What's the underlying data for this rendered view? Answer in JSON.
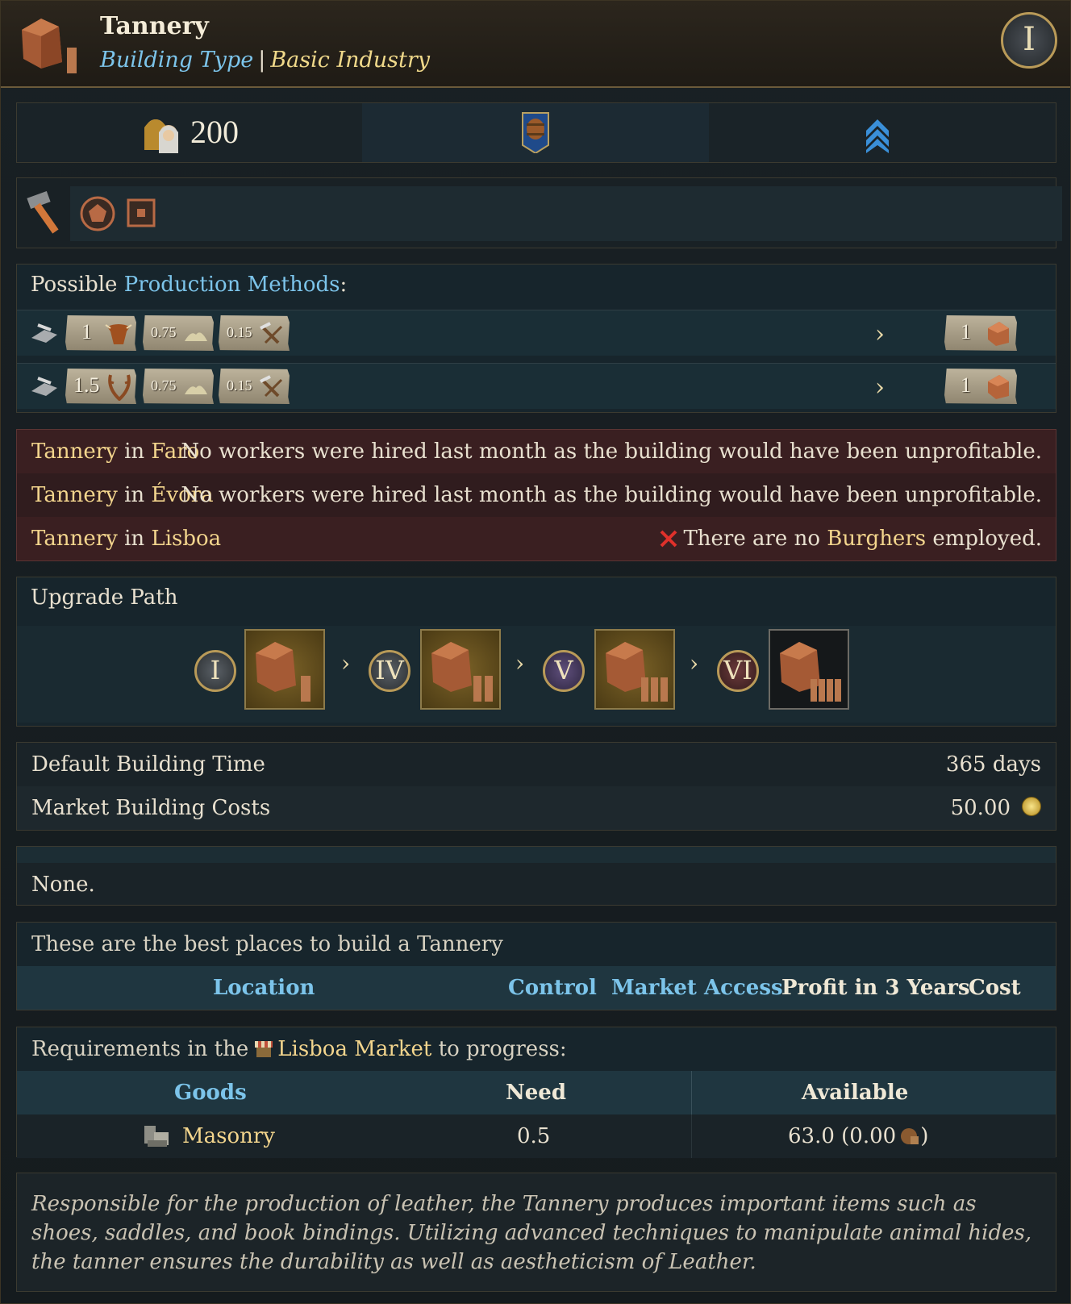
{
  "header": {
    "title": "Tannery",
    "type_label": "Building Type",
    "category": "Basic Industry",
    "tier": "I",
    "icon": "leather-building-icon"
  },
  "stats": {
    "population": "200",
    "population_icon": "population-icon",
    "slot2_icon": "barrel-banner-icon",
    "slot3_icon": "double-chevron-icon"
  },
  "tools": {
    "icons": [
      "hammer-icon",
      "pentagon-icon",
      "square-icon"
    ]
  },
  "production": {
    "label_prefix": "Possible",
    "label_highlight": "Production Methods",
    "label_suffix": ":",
    "methods": [
      {
        "inputs": [
          {
            "amount": "1",
            "icon": "cattle-icon"
          },
          {
            "amount": "0.75",
            "icon": "salt-icon"
          },
          {
            "amount": "0.15",
            "icon": "tools-icon"
          }
        ],
        "output": {
          "amount": "1",
          "icon": "leather-icon"
        }
      },
      {
        "inputs": [
          {
            "amount": "1.5",
            "icon": "antlers-icon"
          },
          {
            "amount": "0.75",
            "icon": "salt-icon"
          },
          {
            "amount": "0.15",
            "icon": "tools-icon"
          }
        ],
        "output": {
          "amount": "1",
          "icon": "leather-icon"
        }
      }
    ]
  },
  "issues": [
    {
      "building": "Tannery",
      "in": "in",
      "location": "Faro",
      "message": "No workers were hired last month as the building would have been unprofitable."
    },
    {
      "building": "Tannery",
      "in": "in",
      "location": "Évora",
      "message": "No workers were hired last month as the building would have been unprofitable."
    },
    {
      "building": "Tannery",
      "in": "in",
      "location": "Lisboa",
      "msg_pre": "There are no",
      "msg_hl": "Burghers",
      "msg_post": "employed."
    }
  ],
  "upgrade": {
    "title": "Upgrade Path",
    "tiers": [
      "I",
      "IV",
      "V",
      "VI"
    ]
  },
  "info": {
    "build_time_label": "Default Building Time",
    "build_time_value": "365 days",
    "cost_label": "Market Building Costs",
    "cost_value": "50.00"
  },
  "none_text": "None.",
  "best_places": {
    "title": "These are the best places to build a Tannery",
    "columns": [
      "Location",
      "Control",
      "Market Access",
      "Profit in 3 Years",
      "Cost"
    ]
  },
  "requirements": {
    "prefix": "Requirements in the",
    "market": "Lisboa Market",
    "suffix": "to progress:",
    "columns": [
      "Goods",
      "Need",
      "Available"
    ],
    "rows": [
      {
        "good": "Masonry",
        "need": "0.5",
        "available": "63.0 (0.00",
        "available_close": ")"
      }
    ]
  },
  "description": "Responsible for the production of leather, the Tannery produces important items such as shoes, saddles, and book bindings. Utilizing advanced techniques to manipulate animal hides, the tanner ensures the durability as well as aestheticism of Leather."
}
